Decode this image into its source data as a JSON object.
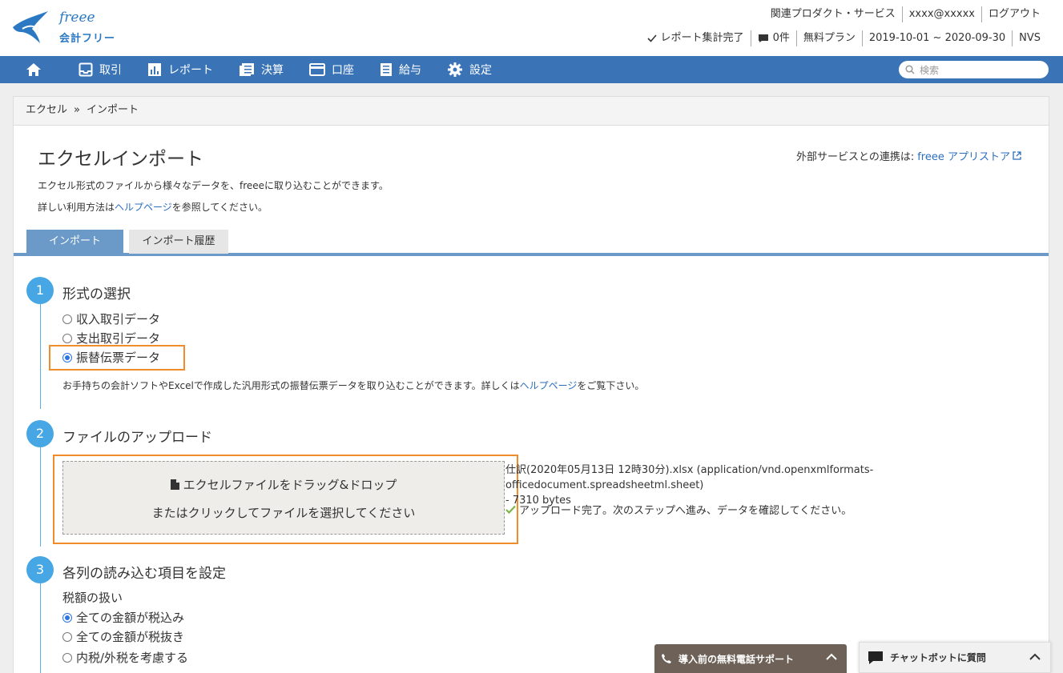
{
  "header": {
    "brand": "freee",
    "product": "会計フリー",
    "links": [
      "関連プロダクト・サービス",
      "xxxx@xxxxx",
      "ログアウト"
    ],
    "status": {
      "report": "レポート集計完了",
      "messages": "0件",
      "plan": "無料プラン",
      "period": "2019-10-01 ~ 2020-09-30",
      "company": "NVS"
    }
  },
  "nav": {
    "items": [
      {
        "label": "取引",
        "icon": "inbox-icon"
      },
      {
        "label": "レポート",
        "icon": "bar-chart-icon"
      },
      {
        "label": "決算",
        "icon": "ledger-icon"
      },
      {
        "label": "口座",
        "icon": "credit-card-icon"
      },
      {
        "label": "給与",
        "icon": "payroll-icon"
      },
      {
        "label": "設定",
        "icon": "gear-icon"
      }
    ],
    "search_placeholder": "検索"
  },
  "breadcrumb": [
    "エクセル",
    "»",
    "インポート"
  ],
  "page": {
    "title": "エクセルインポート",
    "external_label": "外部サービスとの連携は:",
    "external_link": "freee アプリストア",
    "desc1": "エクセル形式のファイルから様々なデータを、freeeに取り込むことができます。",
    "desc2_prefix": "詳しい利用方法は",
    "desc2_link": "ヘルプページ",
    "desc2_suffix": "を参照してください。"
  },
  "tabs": [
    "インポート",
    "インポート履歴"
  ],
  "step1": {
    "number": "1",
    "title": "形式の選択",
    "options": [
      "収入取引データ",
      "支出取引データ",
      "振替伝票データ"
    ],
    "selected_index": 2,
    "note_prefix": "お手持ちの会計ソフトやExcelで作成した汎用形式の振替伝票データを取り込むことができます。詳しくは",
    "note_link": "ヘルプページ",
    "note_suffix": "をご覧下さい。"
  },
  "step2": {
    "number": "2",
    "title": "ファイルのアップロード",
    "drop_line1": "エクセルファイルをドラッグ&ドロップ",
    "drop_line2": "またはクリックしてファイルを選択してください",
    "file_name": "仕訳(2020年05月13日 12時30分).xlsx (application/vnd.openxmlformats-officedocument.spreadsheetml.sheet)",
    "file_size": "- 7310 bytes",
    "upload_status": "アップロード完了。次のステップへ進み、データを確認してください。"
  },
  "step3": {
    "number": "3",
    "title": "各列の読み込む項目を設定",
    "tax_label": "税額の扱い",
    "tax_options": [
      "全ての金額が税込み",
      "全ての金額が税抜き",
      "内税/外税を考慮する"
    ],
    "tax_selected_index": 0
  },
  "widgets": {
    "support": "導入前の無料電話サポート",
    "chatbot": "チャットボットに質問"
  },
  "colors": {
    "nav_bg": "#3a74b7",
    "accent": "#46a7e4",
    "highlight": "#f08c2a",
    "tab_active": "#6b9ac9"
  }
}
